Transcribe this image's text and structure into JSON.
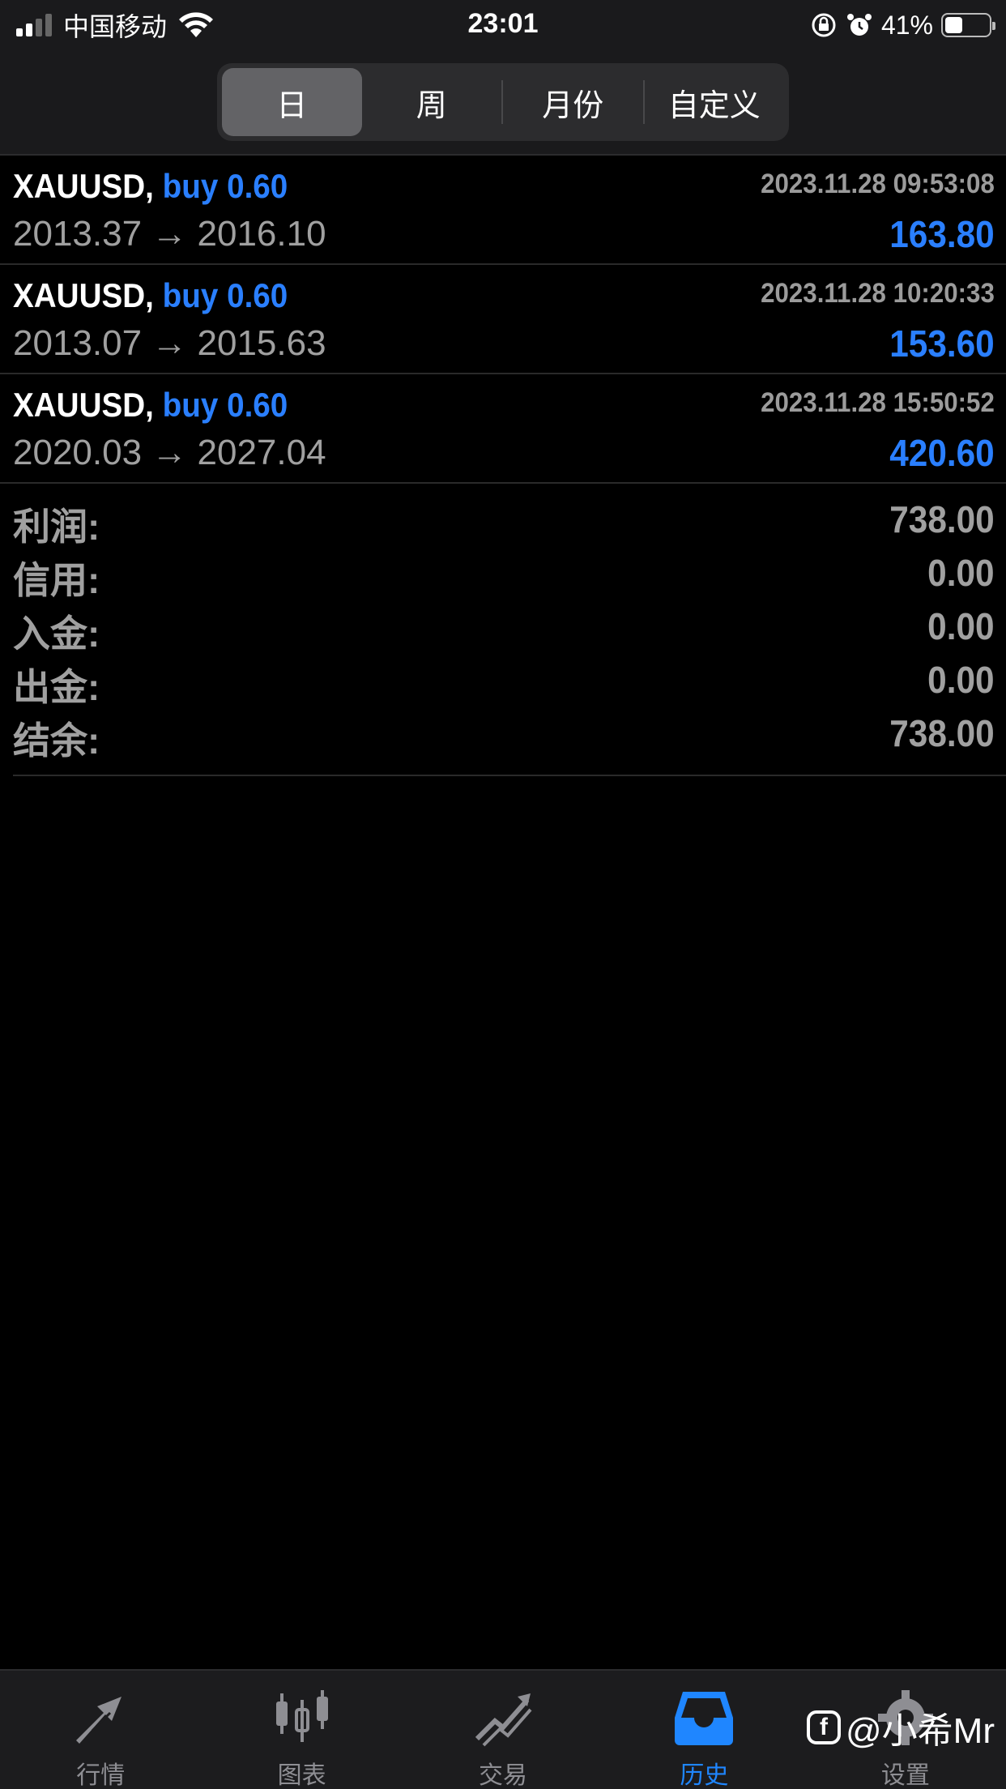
{
  "status_bar": {
    "carrier": "中国移动",
    "time": "23:01",
    "battery_percent": "41%",
    "battery_level": 0.41,
    "icons": [
      "signal-icon",
      "wifi-icon",
      "rotation-lock-icon",
      "alarm-icon",
      "battery-icon"
    ]
  },
  "period_tabs": [
    {
      "label": "日",
      "active": true
    },
    {
      "label": "周",
      "active": false
    },
    {
      "label": "月份",
      "active": false
    },
    {
      "label": "自定义",
      "active": false
    }
  ],
  "trades": [
    {
      "symbol": "XAUUSD,",
      "side": "buy 0.60",
      "time": "2023.11.28 09:53:08",
      "prices": "2013.37 → 2016.10",
      "profit": "163.80"
    },
    {
      "symbol": "XAUUSD,",
      "side": "buy 0.60",
      "time": "2023.11.28 10:20:33",
      "prices": "2013.07 → 2015.63",
      "profit": "153.60"
    },
    {
      "symbol": "XAUUSD,",
      "side": "buy 0.60",
      "time": "2023.11.28 15:50:52",
      "prices": "2020.03 → 2027.04",
      "profit": "420.60"
    }
  ],
  "summary": [
    {
      "label": "利润:",
      "value": "738.00"
    },
    {
      "label": "信用:",
      "value": "0.00"
    },
    {
      "label": "入金:",
      "value": "0.00"
    },
    {
      "label": "出金:",
      "value": "0.00"
    },
    {
      "label": "结余:",
      "value": "738.00"
    }
  ],
  "tab_bar": [
    {
      "label": "行情",
      "icon": "quotes-icon",
      "active": false
    },
    {
      "label": "图表",
      "icon": "chart-icon",
      "active": false
    },
    {
      "label": "交易",
      "icon": "trade-icon",
      "active": false
    },
    {
      "label": "历史",
      "icon": "history-icon",
      "active": true
    },
    {
      "label": "设置",
      "icon": "settings-icon",
      "active": false
    }
  ],
  "watermark": "@小希Mr",
  "colors": {
    "accent": "#1f86ff",
    "profit": "#2a7fff",
    "text_secondary": "#a0a0a0",
    "background": "#000000"
  }
}
